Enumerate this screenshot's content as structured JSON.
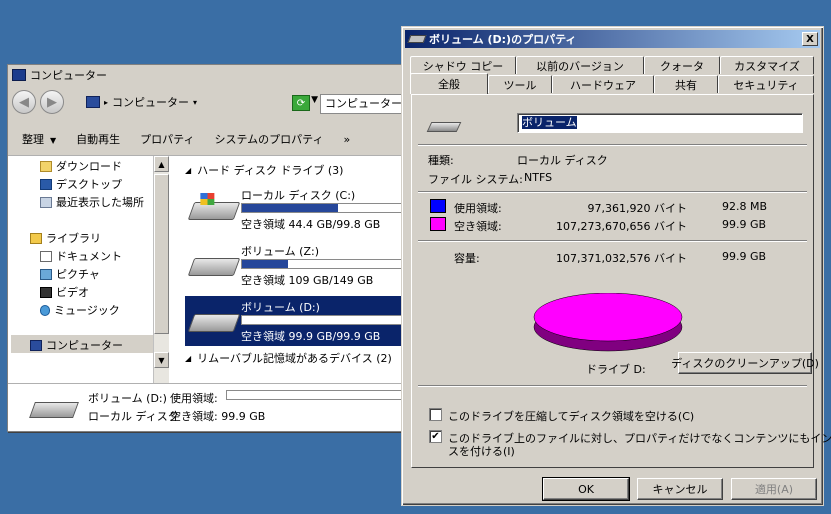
{
  "explorer": {
    "title": "コンピューター",
    "address": "コンピューター",
    "address_caret": "▸",
    "search_text": "コンピューターの検",
    "commands": {
      "organize": "整理",
      "autoplay": "自動再生",
      "properties": "プロパティ",
      "system_properties": "システムのプロパティ",
      "more": "»"
    },
    "nav": {
      "downloads": "ダウンロード",
      "desktop": "デスクトップ",
      "recent": "最近表示した場所",
      "libraries": "ライブラリ",
      "documents": "ドキュメント",
      "pictures": "ピクチャ",
      "videos": "ビデオ",
      "music": "ミュージック",
      "computer": "コンピューター"
    },
    "groups": {
      "hdd": "ハード ディスク ドライブ (3)",
      "removable": "リムーバブル記憶域があるデバイス (2)"
    },
    "drives": [
      {
        "name": "ローカル ディスク (C:)",
        "free": "空き領域 44.4 GB/99.8 GB",
        "used_fraction": 0.56
      },
      {
        "name": "ボリューム (Z:)",
        "free": "空き領域 109 GB/149 GB",
        "used_fraction": 0.27
      },
      {
        "name": "ボリューム (D:)",
        "free": "空き領域 99.9 GB/99.9 GB",
        "used_fraction": 0.01
      }
    ],
    "details": {
      "name": "ボリューム (D:)",
      "used_label": "使用領域:",
      "type": "ローカル ディスク",
      "free": "空き領域: 99.9 GB"
    }
  },
  "dialog": {
    "title": "ボリューム (D:)のプロパティ",
    "close": "X",
    "tabs_back": [
      "シャドウ コピー",
      "以前のバージョン",
      "クォータ",
      "カスタマイズ"
    ],
    "tabs_front": [
      "全般",
      "ツール",
      "ハードウェア",
      "共有",
      "セキュリティ"
    ],
    "active_tab": "全般",
    "volume_name": "ボリューム",
    "type_label": "種類:",
    "type_value": "ローカル ディスク",
    "fs_label": "ファイル システム:",
    "fs_value": "NTFS",
    "used": {
      "label": "使用領域:",
      "bytes": "97,361,920 バイト",
      "size": "92.8 MB",
      "color": "#0000ff"
    },
    "free": {
      "label": "空き領域:",
      "bytes": "107,273,670,656 バイト",
      "size": "99.9 GB",
      "color": "#ff00ff"
    },
    "capacity": {
      "label": "容量:",
      "bytes": "107,371,032,576 バイト",
      "size": "99.9 GB"
    },
    "drive_label": "ドライブ D:",
    "cleanup": "ディスクのクリーンアップ(D)",
    "compress_label": "このドライブを圧縮してディスク領域を空ける(C)",
    "compress_checked": false,
    "index_label_1": "このドライブ上のファイルに対し、プロパティだけでなくコンテンツにもインデック",
    "index_label_2": "スを付ける(I)",
    "index_checked": true,
    "check_mark": "✔",
    "ok": "OK",
    "cancel": "キャンセル",
    "apply": "適用(A)"
  }
}
